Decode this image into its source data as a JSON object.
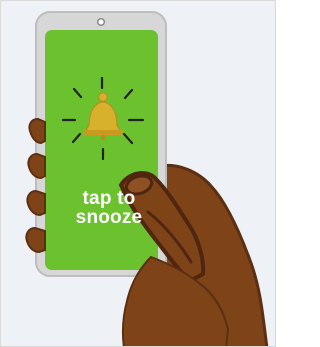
{
  "screen": {
    "line1": "tap to",
    "line2": "snooze"
  },
  "colors": {
    "background": "#eef1f5",
    "phone_body": "#d7d7d7",
    "screen": "#6cc12f",
    "bell": "#d8b12c",
    "skin": "#7f4318",
    "skin_outline": "#4f260f"
  },
  "icons": {
    "bell": "alarm-bell-icon"
  }
}
